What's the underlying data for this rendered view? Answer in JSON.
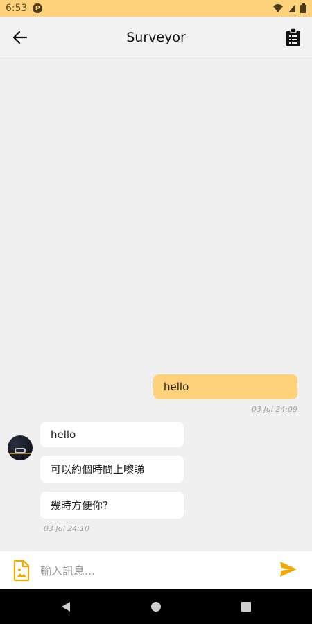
{
  "status_bar": {
    "time": "6:53",
    "app_badge": "P"
  },
  "header": {
    "title": "Surveyor",
    "back_icon": "arrow-left-icon",
    "action_icon": "clipboard-list-icon"
  },
  "messages": [
    {
      "direction": "out",
      "text": "hello"
    },
    {
      "direction": "in",
      "text": "hello"
    },
    {
      "direction": "in",
      "text": "可以約個時間上嚟睇"
    },
    {
      "direction": "in",
      "text": "幾時方便你?"
    }
  ],
  "timestamps": {
    "outgoing": "03 Jul 24:09",
    "incoming": "03 Jul 24:10"
  },
  "composer": {
    "placeholder": "輸入訊息...",
    "attach_icon": "file-image-icon",
    "send_icon": "send-icon"
  },
  "colors": {
    "accent": "#fdd27a",
    "accent_dark": "#f2a900",
    "background": "#f0f0f0"
  }
}
